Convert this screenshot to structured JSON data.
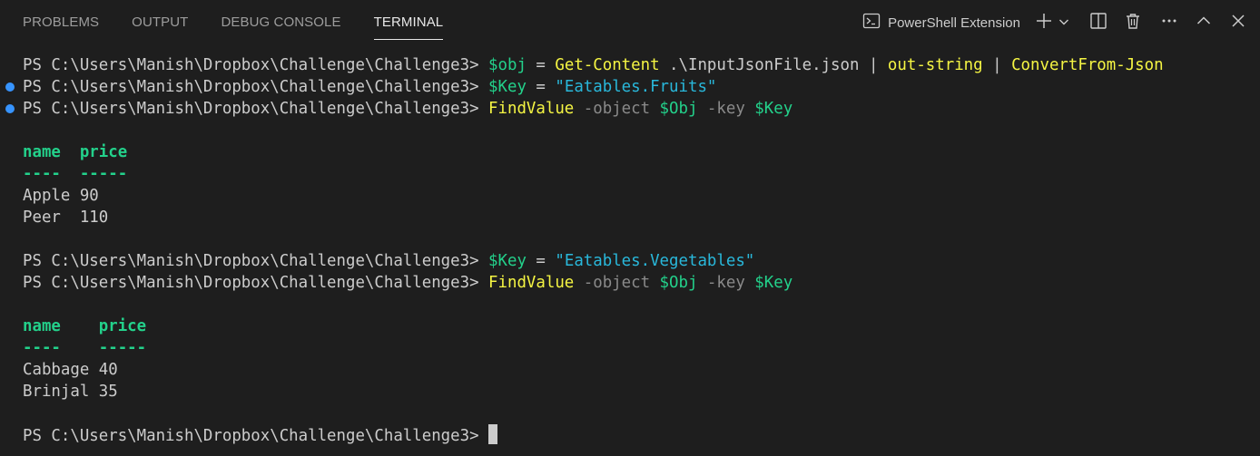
{
  "tabs": [
    {
      "label": "PROBLEMS"
    },
    {
      "label": "OUTPUT"
    },
    {
      "label": "DEBUG CONSOLE"
    },
    {
      "label": "TERMINAL"
    }
  ],
  "active_tab": "TERMINAL",
  "actions": {
    "shell_label": "PowerShell Extension",
    "icons": [
      "terminal-icon",
      "plus-icon",
      "chevron-down-icon",
      "split-icon",
      "trash-icon",
      "more-icon",
      "chevron-up-icon",
      "close-icon"
    ]
  },
  "colors": {
    "background": "#1e1e1e",
    "variable": "#23d18b",
    "command": "#f5f543",
    "string": "#29b8db",
    "parameter": "#8a8a8a",
    "dot": "#3794ff"
  },
  "terminal": {
    "prompt": "PS C:\\Users\\Manish\\Dropbox\\Challenge\\Challenge3>",
    "line1": {
      "var": "$obj",
      "eq": "=",
      "cmd1": "Get-Content",
      "arg": ".\\InputJsonFile.json",
      "pipe1": "|",
      "cmd2": "out-string",
      "pipe2": "|",
      "cmd3": "ConvertFrom-Json"
    },
    "line2": {
      "var": "$Key",
      "eq": "=",
      "str": "\"Eatables.Fruits\""
    },
    "line3": {
      "cmd": "FindValue",
      "p1": "-object",
      "v1": "$Obj",
      "p2": "-key",
      "v2": "$Key"
    },
    "table1": {
      "header": "name  price",
      "dashes": "----  -----",
      "rows": [
        "Apple 90",
        "Peer  110"
      ]
    },
    "line4": {
      "var": "$Key",
      "eq": "=",
      "str": "\"Eatables.Vegetables\""
    },
    "line5": {
      "cmd": "FindValue",
      "p1": "-object",
      "v1": "$Obj",
      "p2": "-key",
      "v2": "$Key"
    },
    "table2": {
      "header": "name    price",
      "dashes": "----    -----",
      "rows": [
        "Cabbage 40",
        "Brinjal 35"
      ]
    }
  }
}
